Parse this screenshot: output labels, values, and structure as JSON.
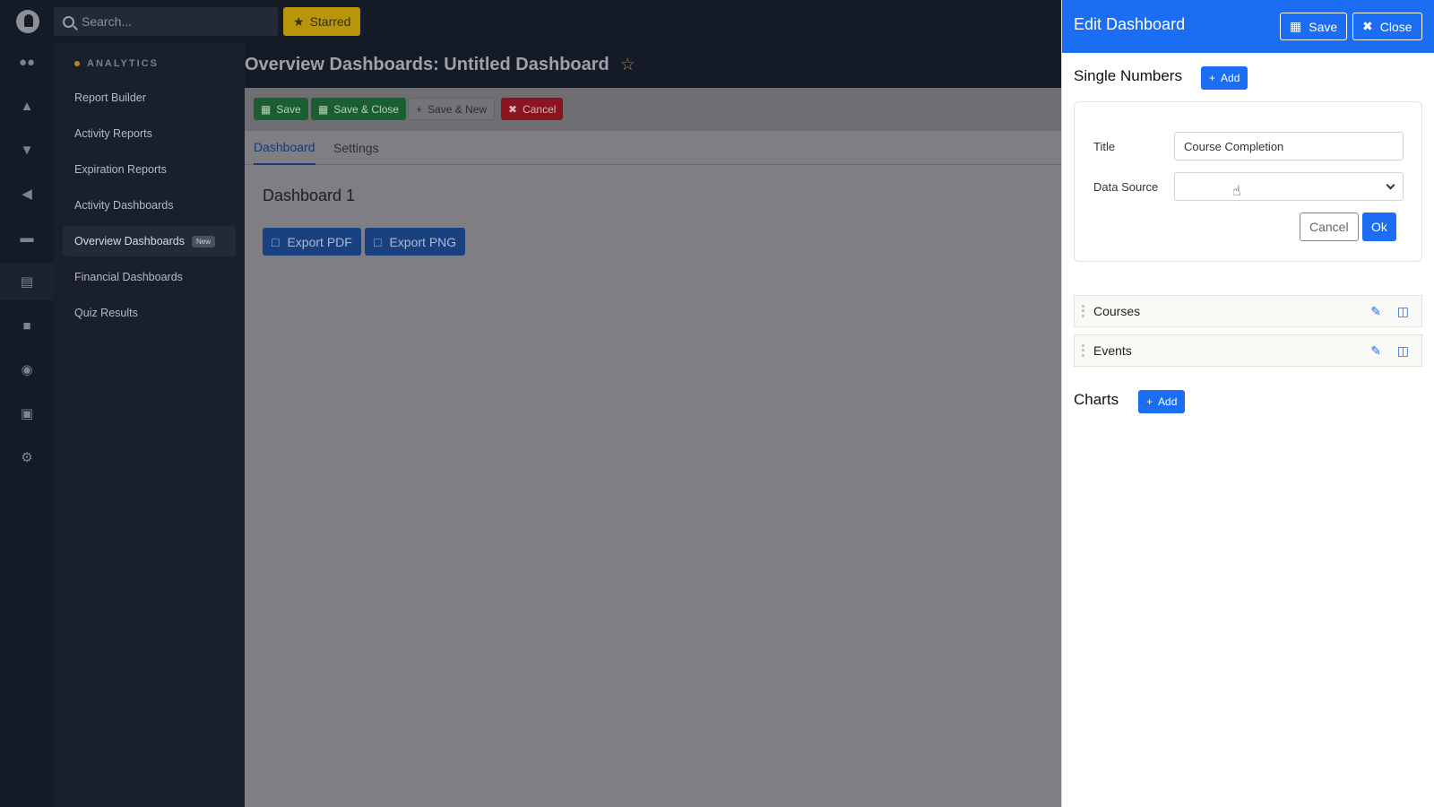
{
  "search": {
    "placeholder": "Search..."
  },
  "topbar": {
    "starred_label": "Starred"
  },
  "sidebar": {
    "section": "ANALYTICS",
    "items": [
      {
        "label": "Report Builder"
      },
      {
        "label": "Activity Reports"
      },
      {
        "label": "Expiration Reports"
      },
      {
        "label": "Activity Dashboards"
      },
      {
        "label": "Overview Dashboards",
        "badge": "New",
        "active": true
      },
      {
        "label": "Financial Dashboards"
      },
      {
        "label": "Quiz Results"
      }
    ]
  },
  "main": {
    "page_title": "Overview Dashboards: Untitled Dashboard",
    "toolbar": {
      "save": "Save",
      "save_close": "Save & Close",
      "save_new": "Save & New",
      "cancel": "Cancel"
    },
    "tabs": [
      "Dashboard",
      "Settings"
    ],
    "dashboard_title": "Dashboard 1",
    "export_pdf": "Export PDF",
    "export_png": "Export PNG"
  },
  "panel": {
    "title": "Edit Dashboard",
    "save": "Save",
    "close": "Close",
    "single_numbers": {
      "heading": "Single Numbers",
      "add": "Add",
      "form": {
        "title_label": "Title",
        "title_value": "Course Completion",
        "source_label": "Data Source",
        "source_value": "",
        "cancel": "Cancel",
        "ok": "Ok"
      },
      "items": [
        "Courses",
        "Events"
      ]
    },
    "charts": {
      "heading": "Charts",
      "add": "Add"
    }
  },
  "colors": {
    "primary": "#1b6ef3",
    "starred": "#b8960b",
    "save_green": "#1a5e32",
    "cancel_red": "#8a1420",
    "analytics_dot": "#c1832c"
  }
}
